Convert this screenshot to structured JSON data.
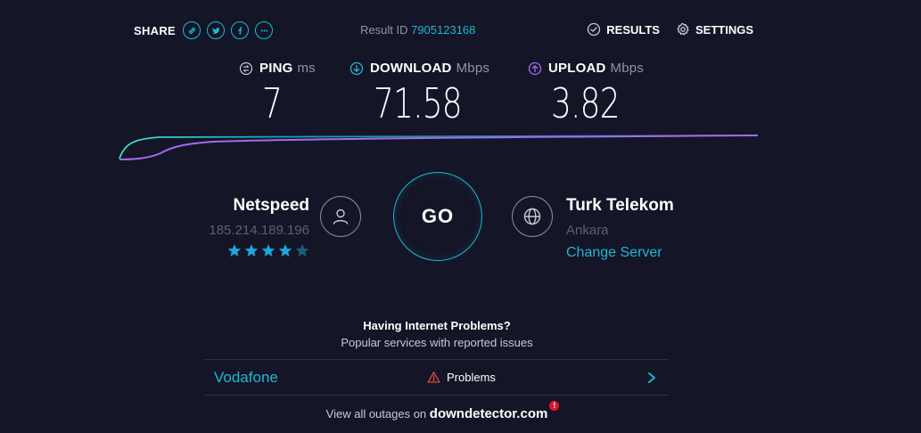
{
  "header": {
    "share_label": "SHARE",
    "result_id_label": "Result ID",
    "result_id": "7905123168",
    "results_label": "RESULTS",
    "settings_label": "SETTINGS"
  },
  "share_icons": [
    "link-icon",
    "twitter-icon",
    "facebook-icon",
    "more-icon"
  ],
  "metrics": {
    "ping": {
      "label": "PING",
      "unit": "ms",
      "value": "7"
    },
    "download": {
      "label": "DOWNLOAD",
      "unit": "Mbps",
      "value": "71.58"
    },
    "upload": {
      "label": "UPLOAD",
      "unit": "Mbps",
      "value": "3.82"
    }
  },
  "host": {
    "name": "Netspeed",
    "ip": "185.214.189.196",
    "rating": 4,
    "rating_max": 5
  },
  "go_label": "GO",
  "server": {
    "name": "Turk Telekom",
    "location": "Ankara",
    "change_label": "Change Server"
  },
  "problems": {
    "title": "Having Internet Problems?",
    "subtitle": "Popular services with reported issues",
    "rows": [
      {
        "isp": "Vodafone",
        "status": "Problems"
      }
    ],
    "footer_text": "View all outages on",
    "footer_brand": "downdetector.com",
    "badge": "!"
  },
  "colors": {
    "background": "#141526",
    "accent": "#1cb8d6",
    "download": "#1cb8d6",
    "upload": "#a36bef",
    "warning": "#e74c3c",
    "muted": "#5d5f74"
  }
}
